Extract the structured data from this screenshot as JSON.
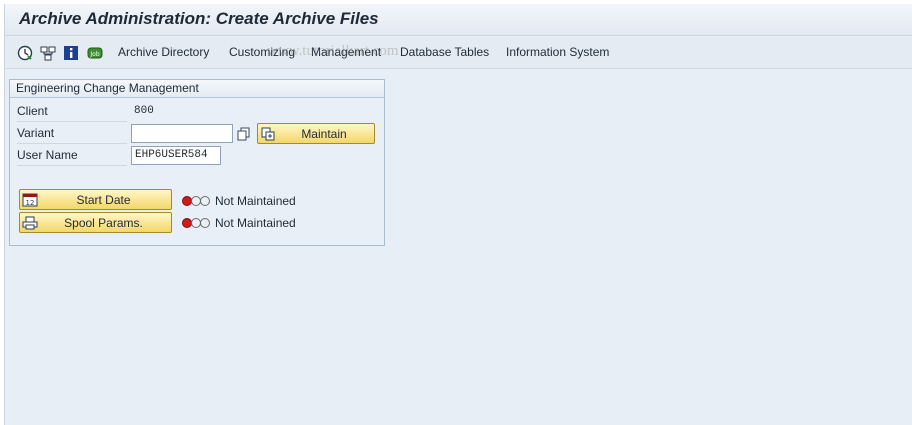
{
  "title_bar": {
    "title": "Archive Administration: Create Archive Files"
  },
  "toolbar": {
    "icons": [
      "clock-execute-icon",
      "hierarchy-icon",
      "info-icon",
      "job-icon"
    ],
    "menu": [
      "Archive Directory",
      "Customizing",
      "Management",
      "Database Tables",
      "Information System"
    ]
  },
  "watermark": "www.tutorialkart.com",
  "group": {
    "title": "Engineering Change Management",
    "client_label": "Client",
    "client_value": "800",
    "variant_label": "Variant",
    "variant_value": "",
    "maintain_label": "Maintain",
    "user_label": "User Name",
    "user_value": "EHP6USER584",
    "start_date_label": "Start Date",
    "spool_params_label": "Spool Params.",
    "start_date_status": "Not Maintained",
    "spool_params_status": "Not Maintained"
  },
  "colors": {
    "button": "#f3d76a",
    "status_red": "#d11a1a",
    "background": "#e8eef5"
  }
}
